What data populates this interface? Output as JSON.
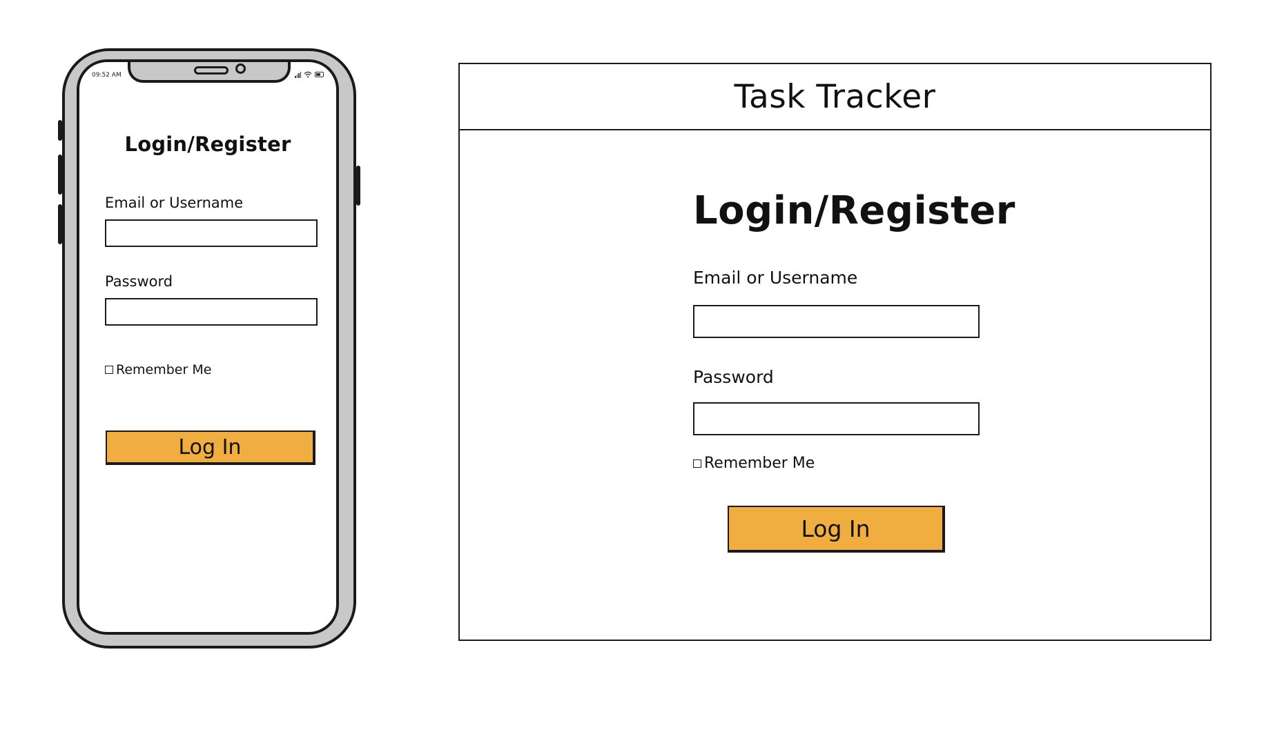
{
  "mobile": {
    "status_bar": {
      "time": "09:52 AM",
      "icons": [
        "signal-icon",
        "wifi-icon",
        "battery-icon"
      ]
    },
    "form": {
      "title": "Login/Register",
      "email_label": "Email or Username",
      "email_value": "",
      "password_label": "Password",
      "password_value": "",
      "remember_label": "Remember Me",
      "remember_checked": false,
      "login_button": "Log In"
    }
  },
  "desktop": {
    "app_title": "Task Tracker",
    "form": {
      "title": "Login/Register",
      "email_label": "Email or Username",
      "email_value": "",
      "password_label": "Password",
      "password_value": "",
      "remember_label": "Remember Me",
      "remember_checked": false,
      "login_button": "Log In"
    }
  },
  "colors": {
    "button_fill": "#f0ad40",
    "phone_frame": "#c8c8c8",
    "outline": "#1a1a1a"
  }
}
